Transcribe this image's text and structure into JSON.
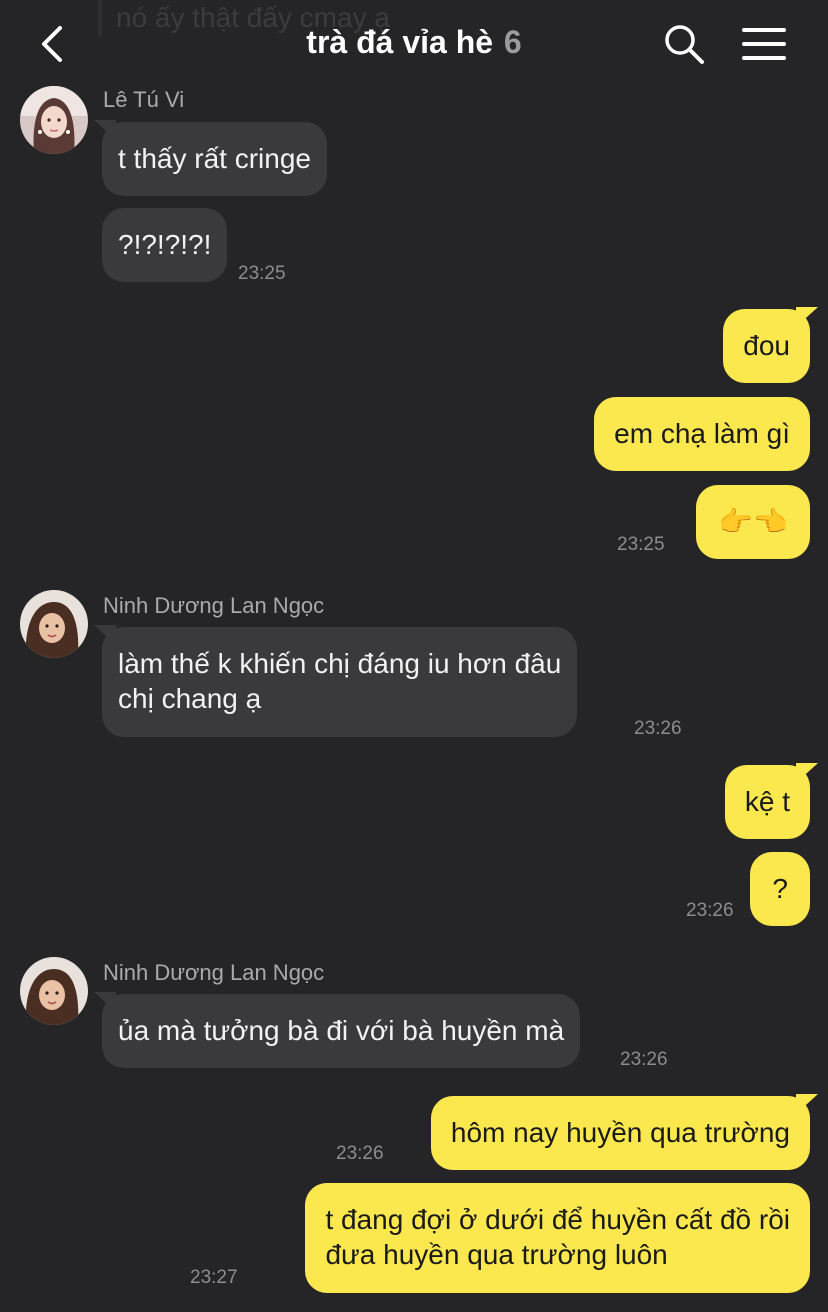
{
  "header": {
    "ghost_preview": "nó ấy thật đấy cmay ạ",
    "title": "trà đá vỉa hè",
    "member_count": "6",
    "back_icon": "chevron-left-icon",
    "search_icon": "search-icon",
    "menu_icon": "hamburger-menu-icon"
  },
  "colors": {
    "background": "#252527",
    "incoming_bubble": "#3a3a3d",
    "outgoing_bubble": "#fbe84e",
    "timestamp": "#8c8c91",
    "sender_name": "#a9a9ae"
  },
  "messages": {
    "g1": {
      "sender": "Lê Tú Vi",
      "m1": "t thấy rất cringe",
      "m2": "?!?!?!?!",
      "time": "23:25"
    },
    "o1": {
      "m1": "đou",
      "m2": "em chạ làm gì",
      "m3": "👉👈",
      "time": "23:25"
    },
    "g2": {
      "sender": "Ninh Dương Lan Ngọc",
      "line1": "làm thế k khiến chị đáng iu hơn đâu",
      "line2": "chị chang ạ",
      "time": "23:26"
    },
    "o2": {
      "m1": "kệ t",
      "m2": "?",
      "time": "23:26"
    },
    "g3": {
      "sender": "Ninh Dương Lan Ngọc",
      "m1": "ủa mà tưởng bà đi với bà huyền mà",
      "time": "23:26"
    },
    "o3": {
      "m1": "hôm nay huyền qua trường",
      "m1_time": "23:26",
      "line1": "t đang đợi ở dưới để huyền cất đồ rồi",
      "line2": "đưa huyền qua trường luôn",
      "m2_time": "23:27"
    }
  }
}
